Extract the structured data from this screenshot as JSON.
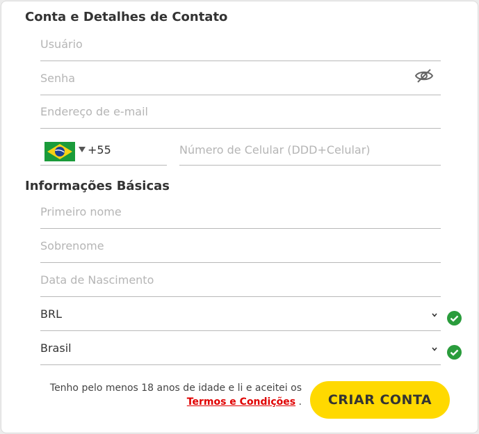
{
  "sections": {
    "account": "Conta e Detalhes de Contato",
    "basic": "Informações Básicas"
  },
  "fields": {
    "username_placeholder": "Usuário",
    "password_placeholder": "Senha",
    "email_placeholder": "Endereço de e-mail",
    "phone_code": "+55",
    "phone_placeholder": "Número de Celular (DDD+Celular)",
    "first_name_placeholder": "Primeiro nome",
    "last_name_placeholder": "Sobrenome",
    "dob_placeholder": "Data de Nascimento",
    "currency_value": "BRL",
    "country_value": "Brasil"
  },
  "footer": {
    "terms_text": "Tenho pelo menos 18 anos de idade e li e aceitei os",
    "terms_link": "Termos e Condições",
    "terms_suffix": ".",
    "submit_label": "CRIAR CONTA"
  },
  "icons": {
    "password_toggle": "eye-slash-icon",
    "flag": "brazil-flag-icon",
    "dropdown": "chevron-down-icon",
    "valid": "check-circle-icon"
  },
  "colors": {
    "accent": "#ffd900",
    "link": "#e00000",
    "valid": "#2a9c3c"
  }
}
